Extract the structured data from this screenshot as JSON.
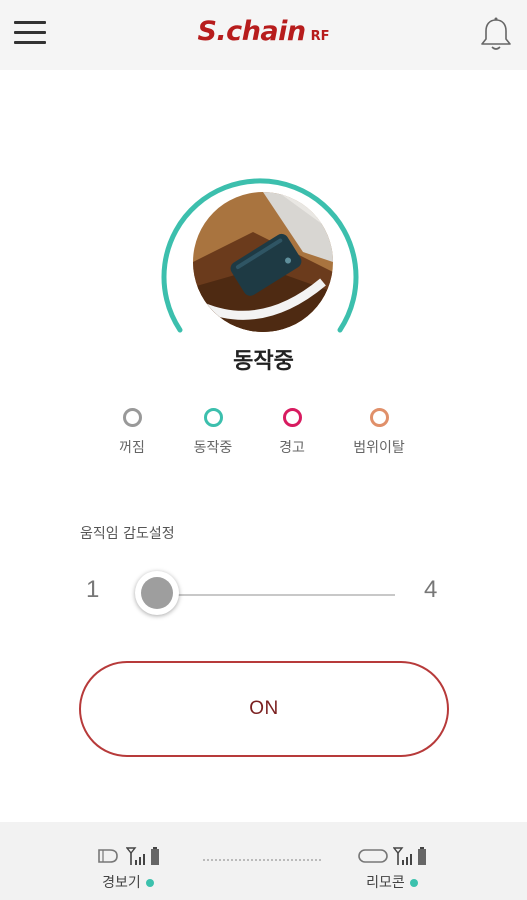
{
  "header": {
    "logo_main": "S.chain",
    "logo_sub": "RF",
    "menu_icon": "hamburger-menu-icon",
    "bell_icon": "bell-icon"
  },
  "status": {
    "current": "동작중",
    "ring_color": "#3cbfad",
    "photo": "device-photo"
  },
  "legend": [
    {
      "label": "꺼짐",
      "color": "#999999"
    },
    {
      "label": "동작중",
      "color": "#3cbfad"
    },
    {
      "label": "경고",
      "color": "#d81b60"
    },
    {
      "label": "범위이탈",
      "color": "#e0906a"
    }
  ],
  "sensitivity": {
    "label": "움직임 감도설정",
    "min": "1",
    "max": "4",
    "value": 1
  },
  "power_button": {
    "label": "ON",
    "border_color": "#b73a3a"
  },
  "footer": {
    "alarm_label": "경보기",
    "remote_label": "리모콘",
    "connected_color": "#3cc1ad"
  }
}
